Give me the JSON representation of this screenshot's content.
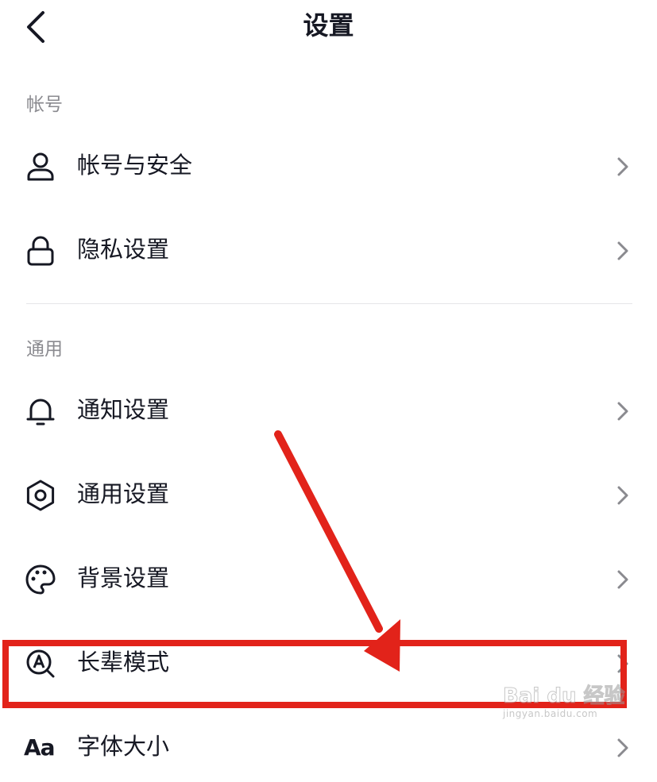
{
  "header": {
    "title": "设置",
    "back_icon": "chevron-left-icon"
  },
  "sections": [
    {
      "label": "帐号",
      "items": [
        {
          "label": "帐号与安全",
          "icon": "user-icon"
        },
        {
          "label": "隐私设置",
          "icon": "lock-icon"
        }
      ]
    },
    {
      "label": "通用",
      "items": [
        {
          "label": "通知设置",
          "icon": "bell-icon"
        },
        {
          "label": "通用设置",
          "icon": "gear-icon"
        },
        {
          "label": "背景设置",
          "icon": "palette-icon"
        },
        {
          "label": "长辈模式",
          "icon": "elder-mode-icon"
        },
        {
          "label": "字体大小",
          "icon": "font-size-icon",
          "icon_text": "Aa"
        }
      ]
    }
  ],
  "annotation": {
    "highlight_color": "#e2231a",
    "highlighted_item": "长辈模式"
  },
  "watermark": {
    "main": "Bai du 经验",
    "sub": "jingyan.baidu.com"
  },
  "colors": {
    "text_primary": "#161823",
    "text_secondary": "#8a8a8f",
    "chevron": "#8a8a8f",
    "divider": "#e6e6e8"
  }
}
